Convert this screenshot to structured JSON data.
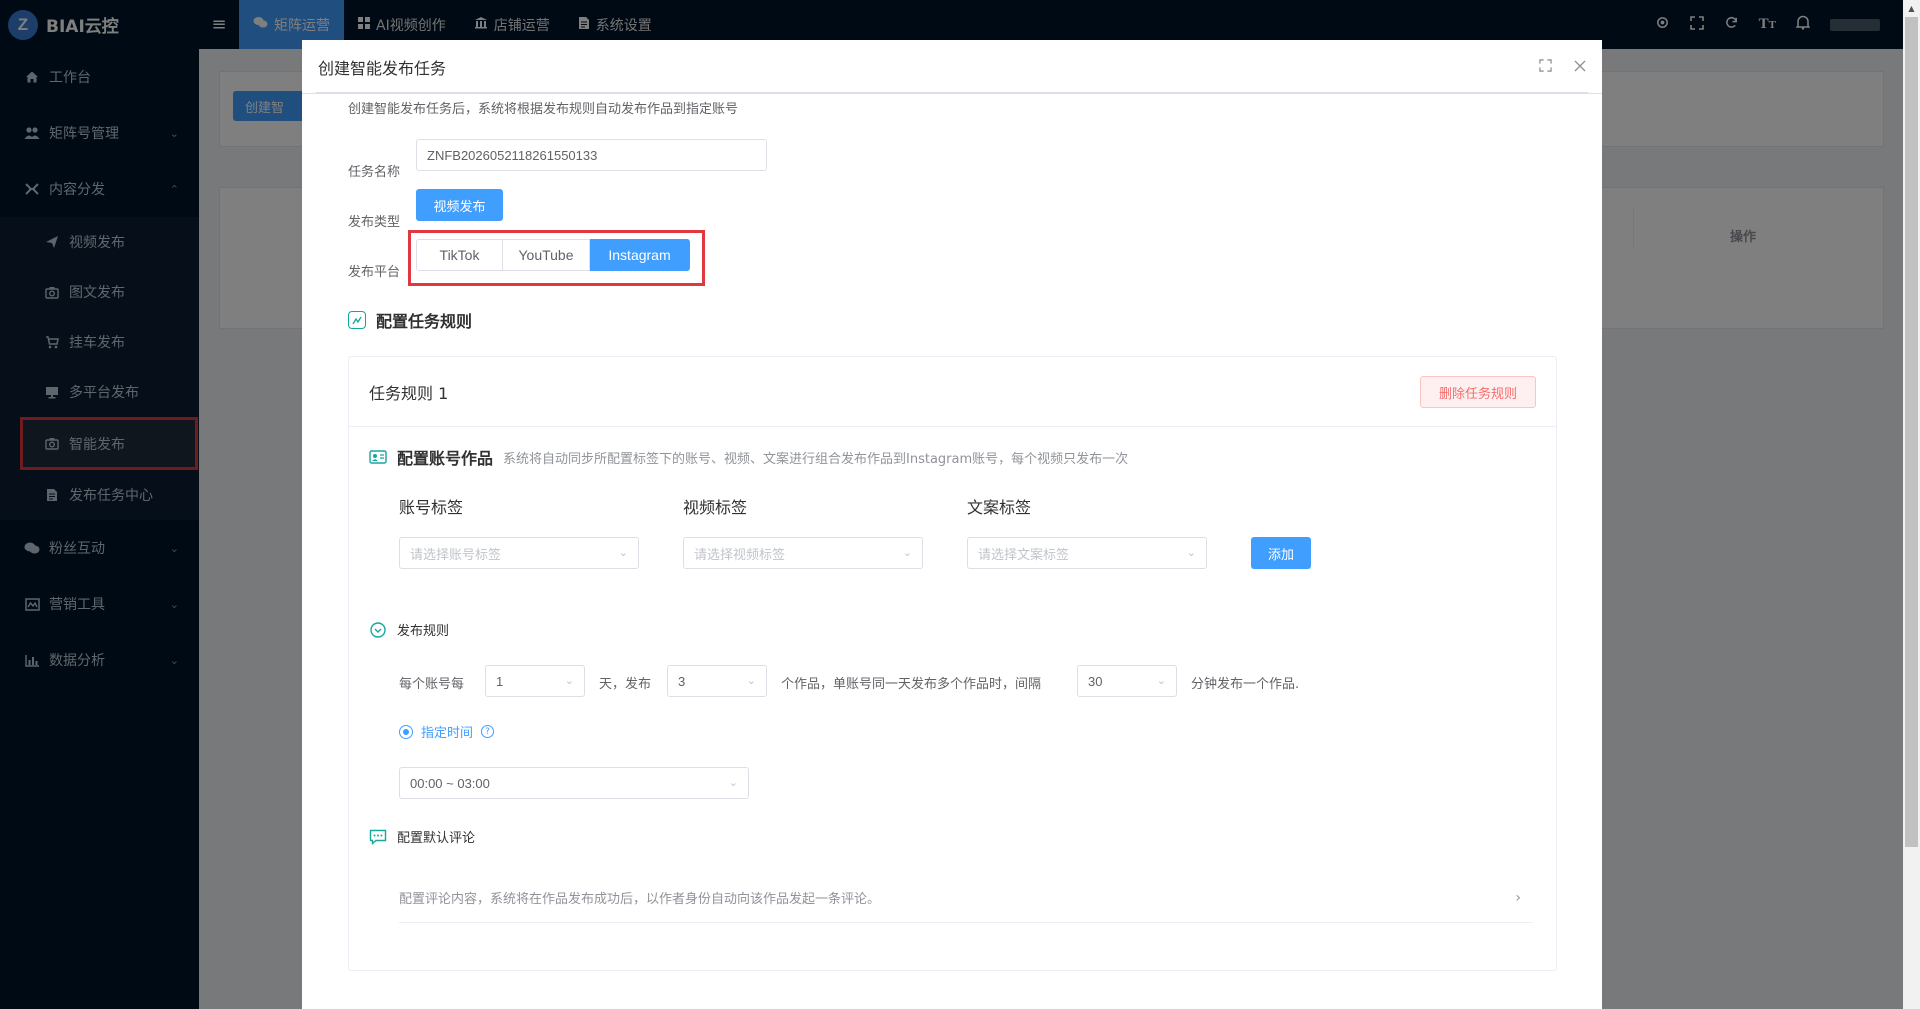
{
  "app": {
    "brand": "BIAI云控",
    "logo_letter": "Z"
  },
  "sidebar": {
    "items": [
      {
        "label": "工作台",
        "icon": "home-icon"
      },
      {
        "label": "矩阵号管理",
        "icon": "users-icon"
      },
      {
        "label": "内容分发",
        "icon": "distribute-icon"
      },
      {
        "label": "粉丝互动",
        "icon": "chat-icon"
      },
      {
        "label": "营销工具",
        "icon": "marketing-icon"
      },
      {
        "label": "数据分析",
        "icon": "chart-icon"
      }
    ],
    "sub_items": [
      {
        "label": "视频发布",
        "icon": "send-icon"
      },
      {
        "label": "图文发布",
        "icon": "camera-icon"
      },
      {
        "label": "挂车发布",
        "icon": "cart-icon"
      },
      {
        "label": "多平台发布",
        "icon": "monitor-icon"
      },
      {
        "label": "智能发布",
        "icon": "camera-icon"
      },
      {
        "label": "发布任务中心",
        "icon": "document-icon"
      }
    ]
  },
  "topbar": {
    "tabs": [
      {
        "label": "矩阵运营",
        "icon": "matrix-icon"
      },
      {
        "label": "AI视频创作",
        "icon": "grid-icon"
      },
      {
        "label": "店铺运营",
        "icon": "store-icon"
      },
      {
        "label": "系统设置",
        "icon": "settings-doc-icon"
      }
    ]
  },
  "background": {
    "create_button": "创建智",
    "op_header": "操作"
  },
  "dialog": {
    "title": "创建智能发布任务",
    "description": "创建智能发布任务后，系统将根据发布规则自动发布作品到指定账号",
    "task_name_label": "任务名称",
    "task_name_value": "ZNFB20260521182615501​33",
    "publish_type_label": "发布类型",
    "publish_type_value": "视频发布",
    "platform_label": "发布平台",
    "platforms": [
      "TikTok",
      "YouTube",
      "Instagram"
    ],
    "platform_selected": "Instagram",
    "section_title": "配置任务规则",
    "rule": {
      "title": "任务规则 1",
      "delete_label": "删除任务规则",
      "account_works_title": "配置账号作品",
      "account_works_desc": "系统将自动同步所配置标签下的账号、视频、文案进行组合发布作品到Instagram账号，每个视频只发布一次",
      "account_tag_label": "账号标签",
      "video_tag_label": "视频标签",
      "copy_tag_label": "文案标签",
      "account_tag_placeholder": "请选择账号标签",
      "video_tag_placeholder": "请选择视频标签",
      "copy_tag_placeholder": "请选择文案标签",
      "add_label": "添加",
      "publish_rule_title": "发布规则",
      "per_account_every": "每个账号每",
      "days_value": "1",
      "days_publish": "天，发布",
      "count_value": "3",
      "works_text": "个作品，单账号同一天发布多个作品时，间隔",
      "interval_value": "30",
      "minutes_text": "分钟发布一个作品.",
      "time_mode": "指定时间",
      "time_range": "00:00 ~ 03:00",
      "comment_title": "配置默认评论",
      "comment_desc": "配置评论内容，系统将在作品发布成功后，以作者身份自动向该作品发起一条评论。"
    }
  }
}
